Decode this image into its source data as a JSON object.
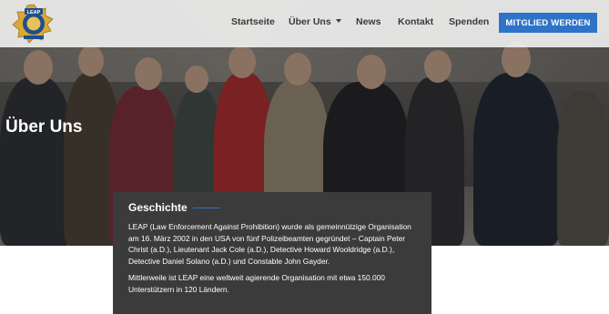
{
  "header": {
    "logo_text": "LEAP",
    "nav": [
      {
        "label": "Startseite"
      },
      {
        "label": "Über Uns"
      },
      {
        "label": "News"
      },
      {
        "label": "Kontakt"
      },
      {
        "label": "Spenden"
      }
    ],
    "cta_label": "MITGLIED WERDEN"
  },
  "hero": {
    "title": "Über Uns"
  },
  "history": {
    "title": "Geschichte",
    "paragraph1": "LEAP (Law Enforcement Against Prohibition) wurde als gemeinnützige Organisation am 16. März 2002 in den USA von fünf Polizeibeamten gegründet – Captain Peter Christ (a.D.), Lieutenant Jack Cole (a.D.), Detective Howard Wooldridge (a.D.), Detective Daniel Solano (a.D.) und Constable John Gayder.",
    "paragraph2": "Mittlerweile ist LEAP eine weltweit agierende Organisation mit etwa 150.000 Unterstützern in 120 Ländern."
  },
  "colors": {
    "accent": "#2f73c8",
    "card_bg": "#3b3b3b",
    "header_bg": "#f5f5f5"
  }
}
